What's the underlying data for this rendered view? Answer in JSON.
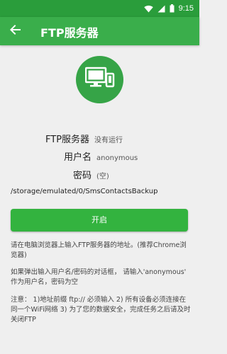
{
  "status_bar": {
    "time": "9:15",
    "icons": [
      "wifi-icon",
      "signal-icon",
      "battery-icon"
    ],
    "color": "#2a9d3b"
  },
  "toolbar": {
    "title": "FTP服务器",
    "back_icon": "arrow-back-icon",
    "color": "#3aae4b"
  },
  "logo": {
    "icon": "desktop-and-phone-icon",
    "color": "#36a447"
  },
  "info": {
    "server_label": "FTP服务器",
    "server_status": "没有运行",
    "username_label": "用户名",
    "username_value": "anonymous",
    "password_label": "密码",
    "password_value": "(空)",
    "path": "/storage/emulated/0/SmsContactsBackup"
  },
  "start_button": {
    "label": "开启",
    "color": "#33b33f"
  },
  "instructions": [
    "请在电脑浏览器上输入FTP服务器的地址。(推荐Chrome浏览器)",
    "如果弹出输入用户名/密码的对话框， 请输入'anonymous' 作为用户名，密码为空",
    "注意： 1)地址前缀 ftp:// 必须输入 2) 所有设备必须连接在同一个WiFi网络 3) 为了您的数据安全，完成任务之后请及时关闭FTP"
  ]
}
